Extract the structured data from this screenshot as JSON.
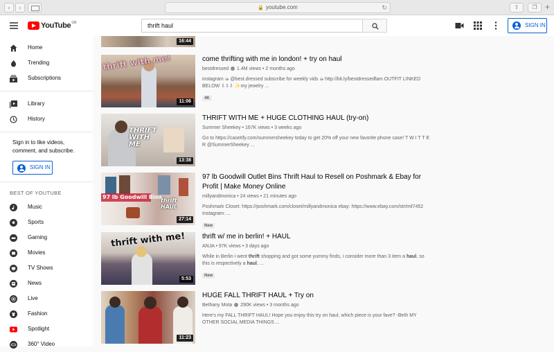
{
  "browser": {
    "url": "youtube.com",
    "back_icon": "chevron-left-icon",
    "forward_icon": "chevron-right-icon"
  },
  "header": {
    "logo_text": "YouTube",
    "logo_region": "GB",
    "search_value": "thrift haul",
    "signin_label": "SIGN IN"
  },
  "sidebar": {
    "primary": [
      {
        "label": "Home",
        "icon": "home-icon"
      },
      {
        "label": "Trending",
        "icon": "flame-icon"
      },
      {
        "label": "Subscriptions",
        "icon": "subscriptions-icon"
      }
    ],
    "secondary": [
      {
        "label": "Library",
        "icon": "library-icon"
      },
      {
        "label": "History",
        "icon": "history-icon"
      }
    ],
    "signin_prompt": "Sign in to like videos, comment, and subscribe.",
    "signin_label": "SIGN IN",
    "best_heading": "BEST OF YOUTUBE",
    "best": [
      {
        "label": "Music"
      },
      {
        "label": "Sports"
      },
      {
        "label": "Gaming"
      },
      {
        "label": "Movies"
      },
      {
        "label": "TV Shows"
      },
      {
        "label": "News"
      },
      {
        "label": "Live"
      },
      {
        "label": "Fashion"
      },
      {
        "label": "Spotlight"
      },
      {
        "label": "360° Video"
      }
    ]
  },
  "results": [
    {
      "duration": "16:44"
    },
    {
      "title": "come thrifting with me in london! + try on haul",
      "channel": "bestdressed",
      "verified": true,
      "views": "1.4M views",
      "age": "2 months ago",
      "desc": "instagram ➭ @best.dressed subscribe for weekly vids ➭ http://bit.ly/bestdressedfam OUTFIT LINKED BELOW ⇩⇩⇩ ✨my jewelry ...",
      "badge": "4K",
      "duration": "11:06",
      "thumb_text": "thrift with me!"
    },
    {
      "title": "THRIFT WITH ME + HUGE CLOTHING HAUL (try-on)",
      "channel": "Summer Sheekey",
      "verified": false,
      "views": "167K views",
      "age": "3 weeks ago",
      "desc": "Go to https://casetify.com/summersheekey today to get 20% off your new favorite phone case! T W I T T E R @SummerSheekey ...",
      "badge": "",
      "duration": "13:38",
      "thumb_text": "THRIFT WITH ME"
    },
    {
      "title": "97 lb Goodwill Outlet Bins Thrift Haul to Resell on Poshmark & Ebay for Profit | Make Money Online",
      "channel": "millyandmonica",
      "verified": false,
      "views": "24 views",
      "age": "21 minutes ago",
      "desc": "Poshmark Closet: https://poshmark.com/closet/millyandmonica ebay: https://www.ebay.com/str/mil7452 Instagram: ...",
      "badge": "New",
      "duration": "27:14",
      "thumb_text": "97 lb Goodwill Bins",
      "thumb_text_2": "thrift HAUL"
    },
    {
      "title": "thrift w/ me in berlin! + HAUL",
      "channel": "ANJA",
      "verified": false,
      "views": "97K views",
      "age": "3 days ago",
      "desc_pre": "While in Berlin i went ",
      "desc_b1": "thrift",
      "desc_mid": " shopping and got some yummy finds, i consider more than 3 item a ",
      "desc_b2": "haul",
      "desc_mid2": ", so this is respectively a ",
      "desc_b3": "haul",
      "desc_post": ", ...",
      "badge": "New",
      "duration": "5:53",
      "thumb_text": "thrift with me!"
    },
    {
      "title": "HUGE FALL THRIFT HAUL + Try on",
      "channel": "Bethany Mota",
      "verified": true,
      "views": "290K views",
      "age": "3 months ago",
      "desc": "Here's my FALL THRIFT HAUL! Hope you enjoy this try on haul, which piece is your fave? -Beth MY OTHER SOCIAL MEDIA THINGS ...",
      "badge": "",
      "duration": "11:23"
    }
  ]
}
